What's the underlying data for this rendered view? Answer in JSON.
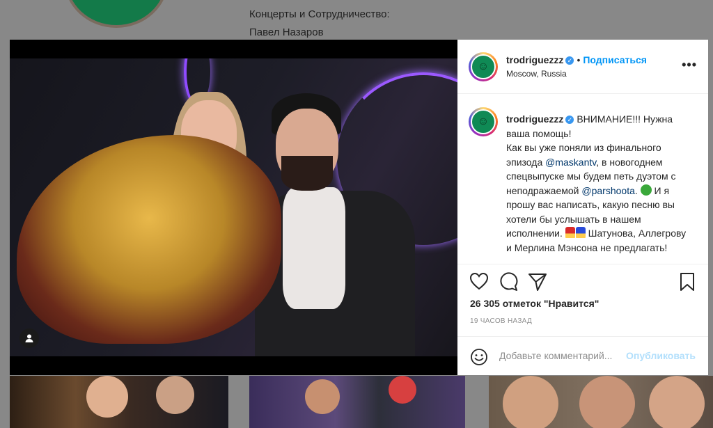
{
  "background": {
    "bio_lines": [
      "Концерты и Сотрудничество:",
      "Павел Назаров"
    ]
  },
  "post": {
    "username": "trodriguezzz",
    "verified": true,
    "separator": "•",
    "follow_label": "Подписаться",
    "location": "Moscow, Russia",
    "more_label": "•••",
    "caption": {
      "username": "trodriguezzz",
      "text_1": " ВНИМАНИЕ!!! Нужна ваша помощь!",
      "text_2": "Как вы уже поняли из финального эпизода ",
      "mention_1": "@maskantv",
      "text_3": ", в новогоднем спецвыпуске мы будем петь дуэтом с неподражаемой ",
      "mention_2": "@parshoota",
      "text_4": ". ",
      "text_5": " И я прошу вас написать, какую песню вы хотели бы услышать в нашем исполнении. ",
      "text_6": " Шатунова, Аллегрову и Мерлина Мэнсона не предлагать!"
    },
    "likes_text": "26 305 отметок \"Нравится\"",
    "timestamp": "19 ЧАСОВ НАЗАД",
    "comment_placeholder": "Добавьте комментарий...",
    "publish_label": "Опубликовать",
    "user_tag_icon": "person-icon"
  },
  "colors": {
    "link": "#0095f6",
    "mention": "#00376b",
    "avatar_bg": "#0f8a55"
  }
}
